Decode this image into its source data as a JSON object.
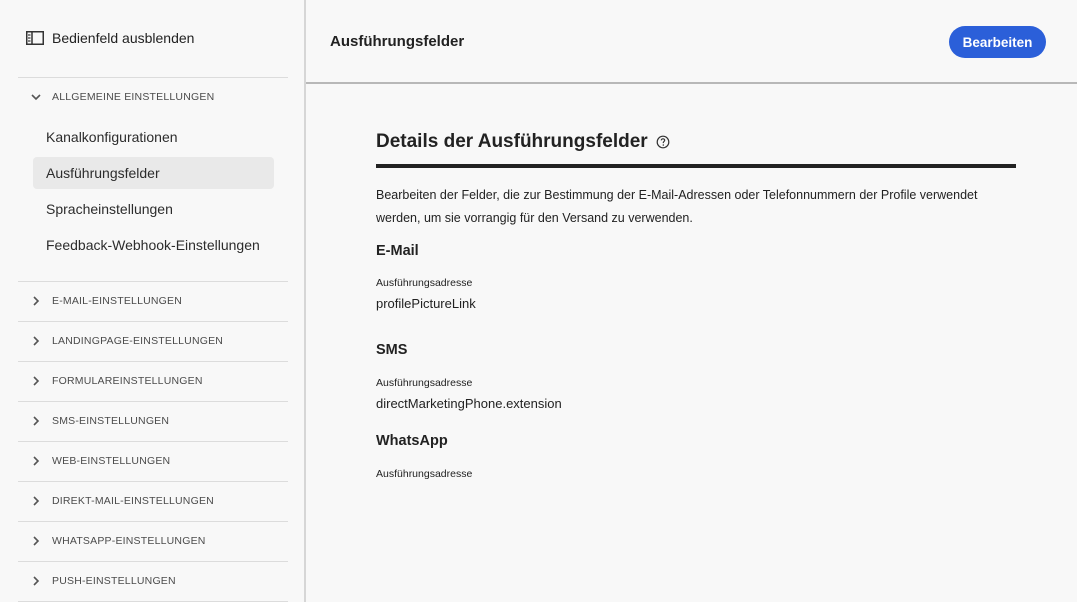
{
  "sidebar": {
    "toggle_label": "Bedienfeld ausblenden",
    "general_section": "ALLGEMEINE EINSTELLUNGEN",
    "items": [
      {
        "label": "Kanalkonfigurationen"
      },
      {
        "label": "Ausführungsfelder"
      },
      {
        "label": "Spracheinstellungen"
      },
      {
        "label": "Feedback-Webhook-Einstellungen"
      }
    ],
    "sections": [
      {
        "label": "E-MAIL-EINSTELLUNGEN"
      },
      {
        "label": "LANDINGPAGE-EINSTELLUNGEN"
      },
      {
        "label": "FORMULAREINSTELLUNGEN"
      },
      {
        "label": "SMS-EINSTELLUNGEN"
      },
      {
        "label": "WEB-EINSTELLUNGEN"
      },
      {
        "label": "DIREKT-MAIL-EINSTELLUNGEN"
      },
      {
        "label": "WHATSAPP-EINSTELLUNGEN"
      },
      {
        "label": "PUSH-EINSTELLUNGEN"
      }
    ]
  },
  "header": {
    "title": "Ausführungsfelder",
    "edit_label": "Bearbeiten"
  },
  "main": {
    "heading": "Details der Ausführungsfelder",
    "description": "Bearbeiten der Felder, die zur Bestimmung der E-Mail-Adressen oder Telefonnummern der Profile verwendet werden, um sie vorrangig für den Versand zu verwenden.",
    "channels": [
      {
        "title": "E-Mail",
        "field_label": "Ausführungsadresse",
        "value": "profilePictureLink"
      },
      {
        "title": "SMS",
        "field_label": "Ausführungsadresse",
        "value": "directMarketingPhone.extension"
      },
      {
        "title": "WhatsApp",
        "field_label": "Ausführungsadresse",
        "value": ""
      }
    ]
  },
  "colors": {
    "accent": "#2b5fd9",
    "active_item_bg": "#e9e9e9"
  }
}
